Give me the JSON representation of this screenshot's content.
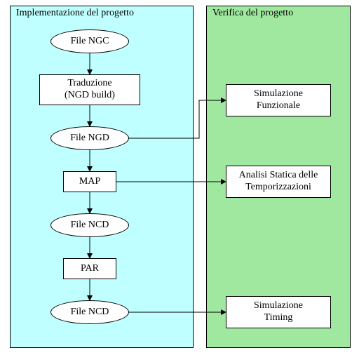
{
  "diagram": {
    "panels": {
      "implementation": {
        "title": "Implementazione del progetto"
      },
      "verification": {
        "title": "Verifica del progetto"
      }
    },
    "flow": {
      "file_ngc": "File NGC",
      "translate": "Traduzione\n(NGD build)",
      "file_ngd": "File NGD",
      "map": "MAP",
      "file_ncd_1": "File NCD",
      "par": "PAR",
      "file_ncd_2": "File NCD"
    },
    "verify": {
      "functional_sim": "Simulazione\nFunzionale",
      "static_timing": "Analisi Statica delle\nTemporizzazioni",
      "timing_sim": "Simulazione\nTiming"
    }
  }
}
